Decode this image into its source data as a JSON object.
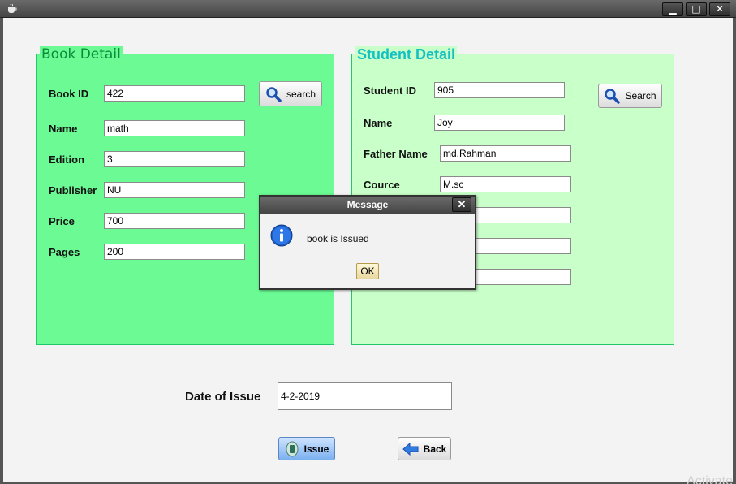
{
  "window": {
    "minimize": "▁",
    "maximize": "□",
    "close": "✕"
  },
  "book_panel": {
    "title": "Book Detail",
    "fields": [
      {
        "label": "Book ID",
        "value": "422"
      },
      {
        "label": "Name",
        "value": "math"
      },
      {
        "label": "Edition",
        "value": "3"
      },
      {
        "label": "Publisher",
        "value": "NU"
      },
      {
        "label": "Price",
        "value": "700"
      },
      {
        "label": "Pages",
        "value": "200"
      }
    ],
    "search_label": "search"
  },
  "student_panel": {
    "title": "Student Detail",
    "fields": [
      {
        "label": "Student ID",
        "value": "905"
      },
      {
        "label": "Name",
        "value": "Joy"
      },
      {
        "label": "Father Name",
        "value": "md.Rahman"
      },
      {
        "label": "Cource",
        "value": "M.sc"
      },
      {
        "label": "",
        "value": ""
      },
      {
        "label": "",
        "value": ""
      },
      {
        "label": "",
        "value": ""
      }
    ],
    "search_label": "Search"
  },
  "issue": {
    "label": "Date of Issue",
    "value": "4-2-2019"
  },
  "buttons": {
    "issue": "Issue",
    "back": "Back"
  },
  "dialog": {
    "title": "Message",
    "message": "book is Issued",
    "ok": "OK",
    "close": "✕"
  },
  "watermark": "Activate"
}
